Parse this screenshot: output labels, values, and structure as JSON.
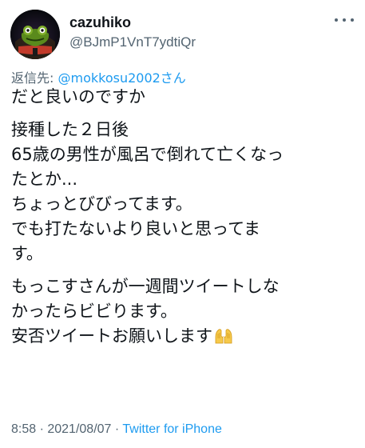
{
  "author": {
    "display_name": "cazuhiko",
    "handle": "@BJmP1VnT7ydtiQr"
  },
  "reply_to": {
    "prefix": "返信先: ",
    "mention": "@mokkosu2002さん"
  },
  "tweet": {
    "paragraphs": [
      [
        "だと良いのですか"
      ],
      [
        "接種した２日後",
        "65歳の男性が風呂で倒れて亡くなっ",
        "たとか...",
        "ちょっとびびってます。",
        "でも打たないより良いと思ってま",
        "す。"
      ],
      [
        "もっこすさんが一週間ツイートしな",
        "かったらビビります。",
        "安否ツイートお願いします"
      ]
    ],
    "trailing_emoji": "folded-hands-emoji"
  },
  "meta": {
    "time": "8:58",
    "separator1": " · ",
    "date": "2021/08/07",
    "separator2": " · ",
    "source": "Twitter for iPhone"
  },
  "colors": {
    "text": "#0f1419",
    "secondary": "#536471",
    "link": "#1d9bf0"
  }
}
